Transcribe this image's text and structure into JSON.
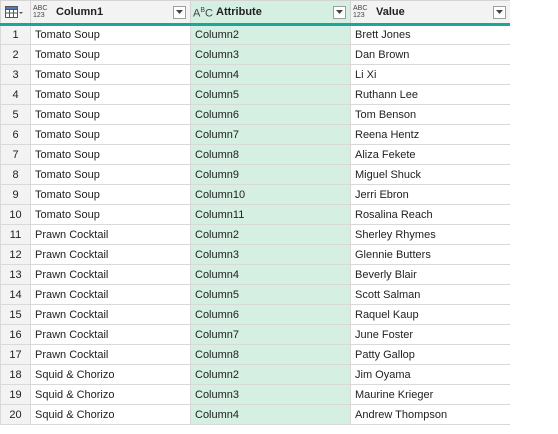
{
  "columns": [
    {
      "type": "ABC\n123",
      "name": "Column1"
    },
    {
      "type": "ABC",
      "name": "Attribute"
    },
    {
      "type": "ABC\n123",
      "name": "Value"
    }
  ],
  "rows": [
    {
      "n": "1",
      "c1": "Tomato Soup",
      "attr": "Column2",
      "val": "Brett Jones"
    },
    {
      "n": "2",
      "c1": "Tomato Soup",
      "attr": "Column3",
      "val": "Dan Brown"
    },
    {
      "n": "3",
      "c1": "Tomato Soup",
      "attr": "Column4",
      "val": "Li Xi"
    },
    {
      "n": "4",
      "c1": "Tomato Soup",
      "attr": "Column5",
      "val": "Ruthann Lee"
    },
    {
      "n": "5",
      "c1": "Tomato Soup",
      "attr": "Column6",
      "val": "Tom Benson"
    },
    {
      "n": "6",
      "c1": "Tomato Soup",
      "attr": "Column7",
      "val": "Reena Hentz"
    },
    {
      "n": "7",
      "c1": "Tomato Soup",
      "attr": "Column8",
      "val": "Aliza Fekete"
    },
    {
      "n": "8",
      "c1": "Tomato Soup",
      "attr": "Column9",
      "val": "Miguel Shuck"
    },
    {
      "n": "9",
      "c1": "Tomato Soup",
      "attr": "Column10",
      "val": "Jerri Ebron"
    },
    {
      "n": "10",
      "c1": "Tomato Soup",
      "attr": "Column11",
      "val": "Rosalina Reach"
    },
    {
      "n": "11",
      "c1": "Prawn Cocktail",
      "attr": "Column2",
      "val": "Sherley Rhymes"
    },
    {
      "n": "12",
      "c1": "Prawn Cocktail",
      "attr": "Column3",
      "val": "Glennie Butters"
    },
    {
      "n": "13",
      "c1": "Prawn Cocktail",
      "attr": "Column4",
      "val": "Beverly Blair"
    },
    {
      "n": "14",
      "c1": "Prawn Cocktail",
      "attr": "Column5",
      "val": "Scott Salman"
    },
    {
      "n": "15",
      "c1": "Prawn Cocktail",
      "attr": "Column6",
      "val": "Raquel Kaup"
    },
    {
      "n": "16",
      "c1": "Prawn Cocktail",
      "attr": "Column7",
      "val": "June Foster"
    },
    {
      "n": "17",
      "c1": "Prawn Cocktail",
      "attr": "Column8",
      "val": "Patty Gallop"
    },
    {
      "n": "18",
      "c1": "Squid & Chorizo",
      "attr": "Column2",
      "val": "Jim Oyama"
    },
    {
      "n": "19",
      "c1": "Squid & Chorizo",
      "attr": "Column3",
      "val": "Maurine Krieger"
    },
    {
      "n": "20",
      "c1": "Squid & Chorizo",
      "attr": "Column4",
      "val": "Andrew Thompson"
    }
  ],
  "colors": {
    "accent": "#1aa79a",
    "selected_column": "#d5efe3",
    "header_bg": "#f3f3f3"
  }
}
